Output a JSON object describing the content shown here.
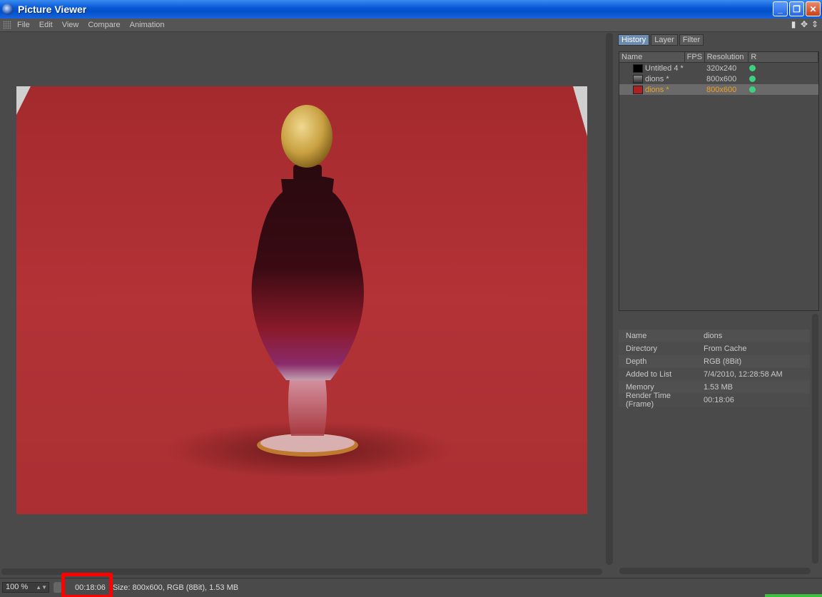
{
  "window": {
    "title": "Picture Viewer",
    "controls": {
      "minimize": "_",
      "restore": "❐",
      "close": "✕"
    }
  },
  "menu": {
    "items": [
      "File",
      "Edit",
      "View",
      "Compare",
      "Animation"
    ]
  },
  "panel": {
    "tabs": [
      "History",
      "Layer",
      "Filter"
    ],
    "active_tab": "History",
    "history": {
      "columns": [
        "Name",
        "FPS",
        "Resolution",
        "R"
      ],
      "rows": [
        {
          "name": "Untitled 4 *",
          "resolution": "320x240"
        },
        {
          "name": "dions *",
          "resolution": "800x600"
        },
        {
          "name": "dions *",
          "resolution": "800x600",
          "selected": true
        }
      ]
    },
    "info": [
      {
        "key": "Name",
        "value": "dions"
      },
      {
        "key": "Directory",
        "value": "From Cache"
      },
      {
        "key": "Depth",
        "value": "RGB (8Bit)"
      },
      {
        "key": "Added to List",
        "value": "7/4/2010, 12:28:58 AM"
      },
      {
        "key": "Memory",
        "value": "1.53 MB"
      },
      {
        "key": "Render Time (Frame)",
        "value": "00:18:06"
      }
    ]
  },
  "status": {
    "zoom": "100 %",
    "render_time": "00:18:06",
    "size_info": "Size: 800x600, RGB (8Bit), 1.53 MB"
  },
  "colors": {
    "titlebar": "#0a5ad8",
    "highlight_box": "#ff0000",
    "status_dot": "#3cd080",
    "selected_text": "#f0a020"
  }
}
